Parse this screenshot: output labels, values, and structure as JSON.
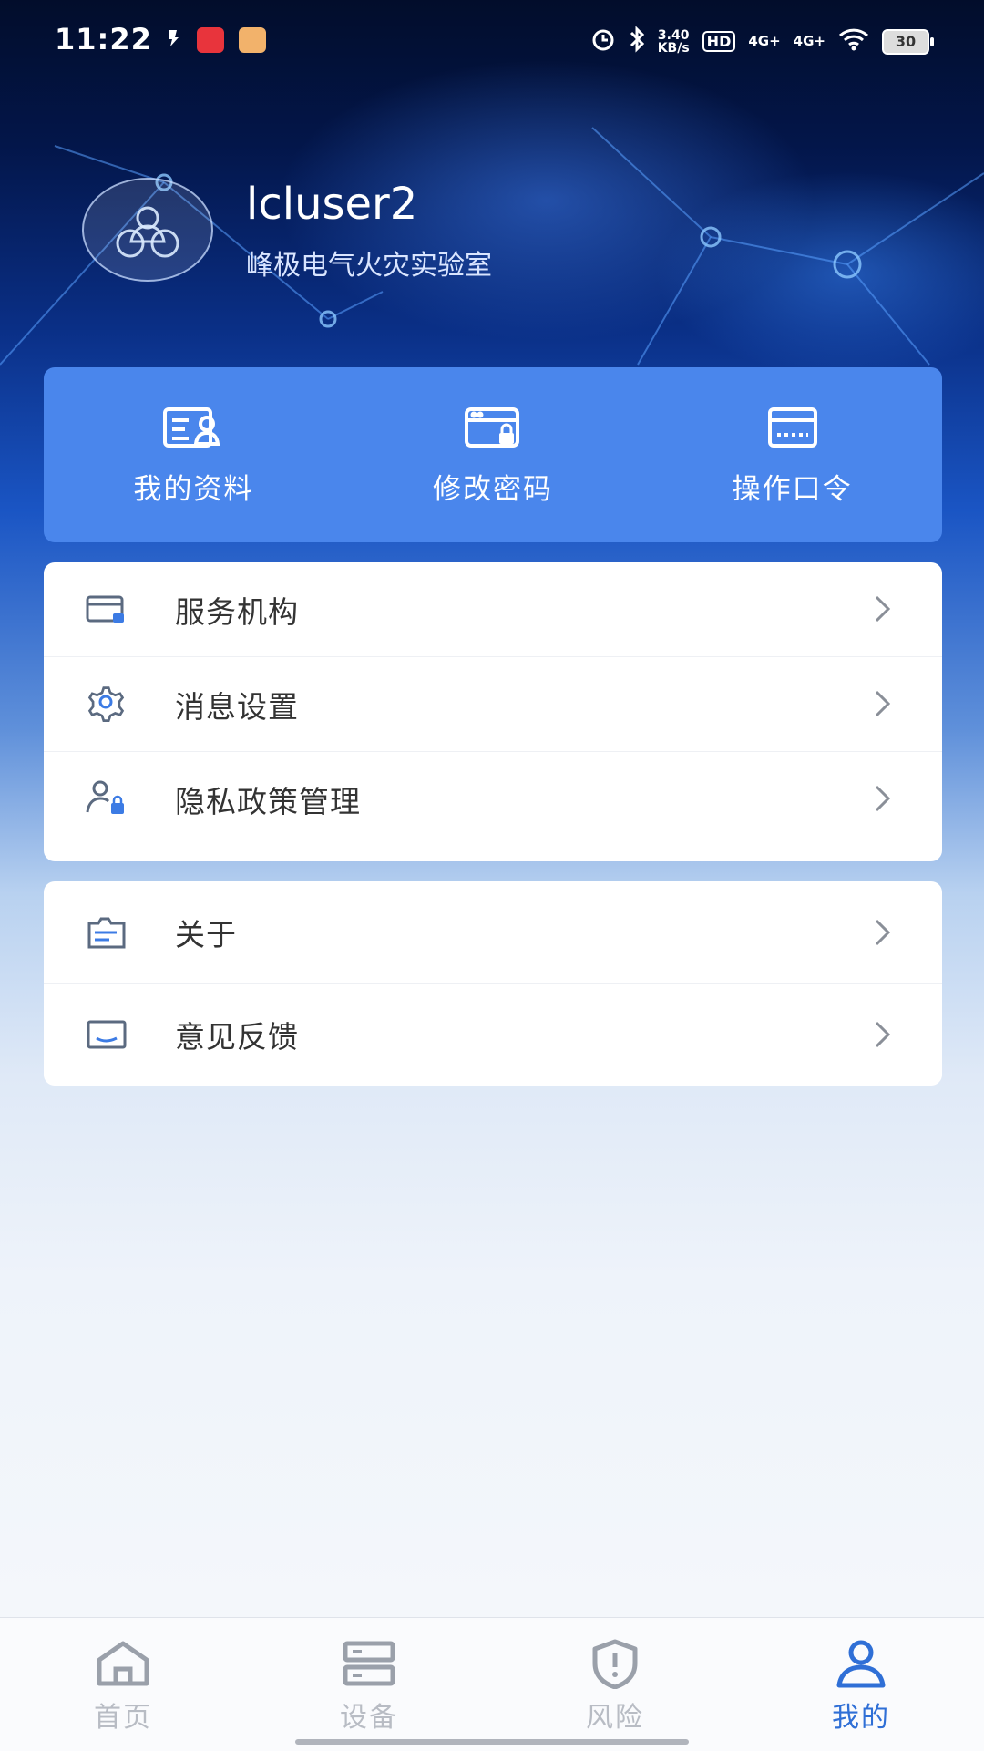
{
  "status_bar": {
    "time": "11:22",
    "speed_value": "3.40",
    "speed_unit": "KB/s",
    "hd": "HD",
    "network1": "4G+",
    "network2": "4G+",
    "battery": "30"
  },
  "profile": {
    "username": "lcluser2",
    "organization": "峰极电气火灾实验室"
  },
  "quick_actions": [
    {
      "label": "我的资料",
      "icon": "profile-card-icon"
    },
    {
      "label": "修改密码",
      "icon": "password-lock-icon"
    },
    {
      "label": "操作口令",
      "icon": "keyboard-icon"
    }
  ],
  "menu_group1": [
    {
      "label": "服务机构",
      "icon": "service-card-icon"
    },
    {
      "label": "消息设置",
      "icon": "gear-icon"
    },
    {
      "label": "隐私政策管理",
      "icon": "user-lock-icon"
    }
  ],
  "menu_group2": [
    {
      "label": "关于",
      "icon": "info-card-icon"
    },
    {
      "label": "意见反馈",
      "icon": "feedback-icon"
    }
  ],
  "tabs": [
    {
      "label": "首页",
      "icon": "home-icon",
      "active": false
    },
    {
      "label": "设备",
      "icon": "device-icon",
      "active": false
    },
    {
      "label": "风险",
      "icon": "shield-alert-icon",
      "active": false
    },
    {
      "label": "我的",
      "icon": "user-icon",
      "active": true
    }
  ],
  "colors": {
    "accent": "#4a86ec",
    "active_tab": "#2f6fd6",
    "inactive_tab": "#b8bcc4"
  }
}
